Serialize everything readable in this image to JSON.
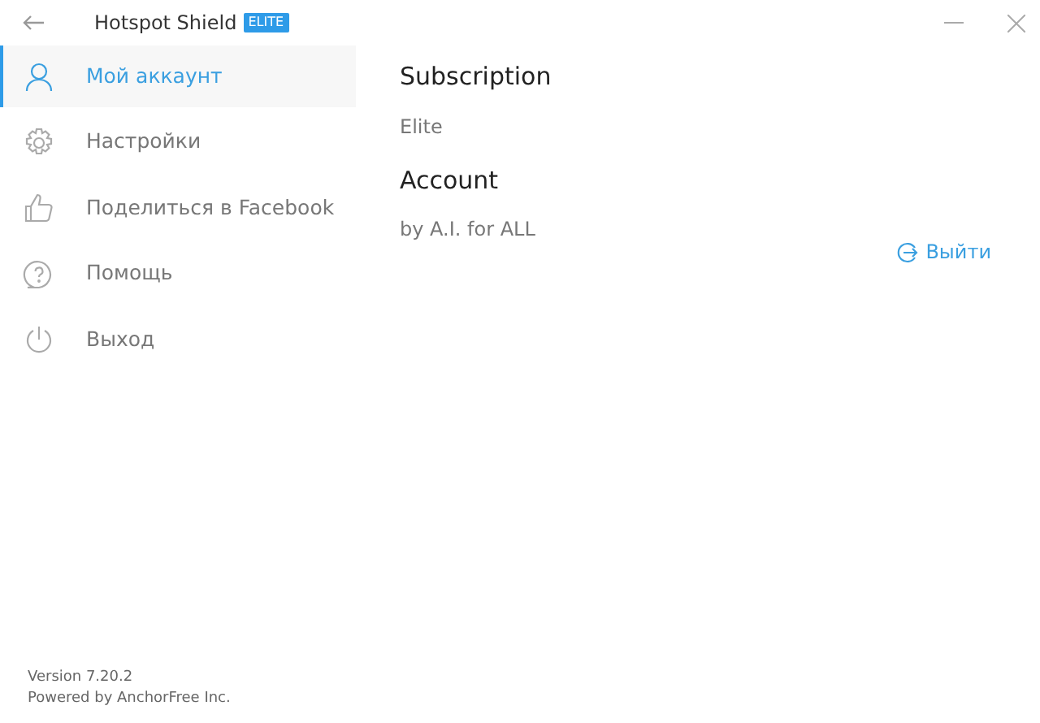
{
  "window": {
    "title": "Hotspot Shield",
    "badge": "ELITE"
  },
  "sidebar": {
    "items": [
      {
        "kind": "user",
        "label": "Мой аккаунт",
        "selected": true
      },
      {
        "kind": "gear",
        "label": "Настройки",
        "selected": false
      },
      {
        "kind": "like",
        "label": "Поделиться в Facebook",
        "selected": false
      },
      {
        "kind": "help",
        "label": "Помощь",
        "selected": false
      },
      {
        "kind": "power",
        "label": "Выход",
        "selected": false
      }
    ],
    "footer": [
      "Version 7.20.2",
      "Powered by AnchorFree Inc."
    ]
  },
  "content": {
    "sections": [
      {
        "heading": "Subscription",
        "value": "Elite"
      },
      {
        "heading": "Account",
        "value": "by A.I. for ALL"
      }
    ],
    "logout_button": "Выйти"
  }
}
